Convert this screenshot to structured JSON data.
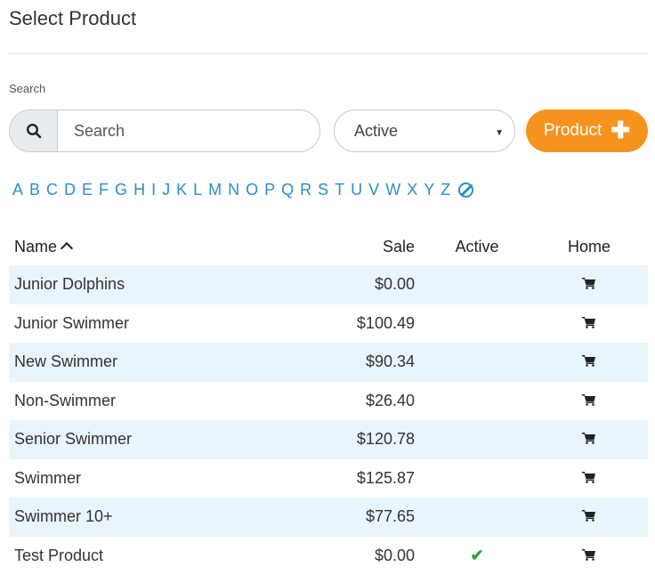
{
  "page": {
    "title": "Select Product"
  },
  "search": {
    "label": "Search",
    "placeholder": "Search"
  },
  "filter": {
    "status_value": "Active"
  },
  "actions": {
    "add_product_label": "Product"
  },
  "alphabet": [
    "A",
    "B",
    "C",
    "D",
    "E",
    "F",
    "G",
    "H",
    "I",
    "J",
    "K",
    "L",
    "M",
    "N",
    "O",
    "P",
    "Q",
    "R",
    "S",
    "T",
    "U",
    "V",
    "W",
    "X",
    "Y",
    "Z"
  ],
  "table": {
    "columns": {
      "name": "Name",
      "sale": "Sale",
      "active": "Active",
      "home": "Home"
    },
    "rows": [
      {
        "name": "Junior Dolphins",
        "sale": "$0.00",
        "active": false
      },
      {
        "name": "Junior Swimmer",
        "sale": "$100.49",
        "active": false
      },
      {
        "name": "New Swimmer",
        "sale": "$90.34",
        "active": false
      },
      {
        "name": "Non-Swimmer",
        "sale": "$26.40",
        "active": false
      },
      {
        "name": "Senior Swimmer",
        "sale": "$120.78",
        "active": false
      },
      {
        "name": "Swimmer",
        "sale": "$125.87",
        "active": false
      },
      {
        "name": "Swimmer 10+",
        "sale": "$77.65",
        "active": false
      },
      {
        "name": "Test Product",
        "sale": "$0.00",
        "active": true
      }
    ]
  },
  "colors": {
    "accent": "#f6921e",
    "link": "#2d8ec3",
    "row_stripe": "#e8f5fc",
    "check": "#2ea43e"
  },
  "icons": {
    "search": "search-icon",
    "clear_filter": "clear-filter-icon",
    "sort": "sort-asc-icon",
    "cart": "cart-icon",
    "check": "check-icon"
  }
}
